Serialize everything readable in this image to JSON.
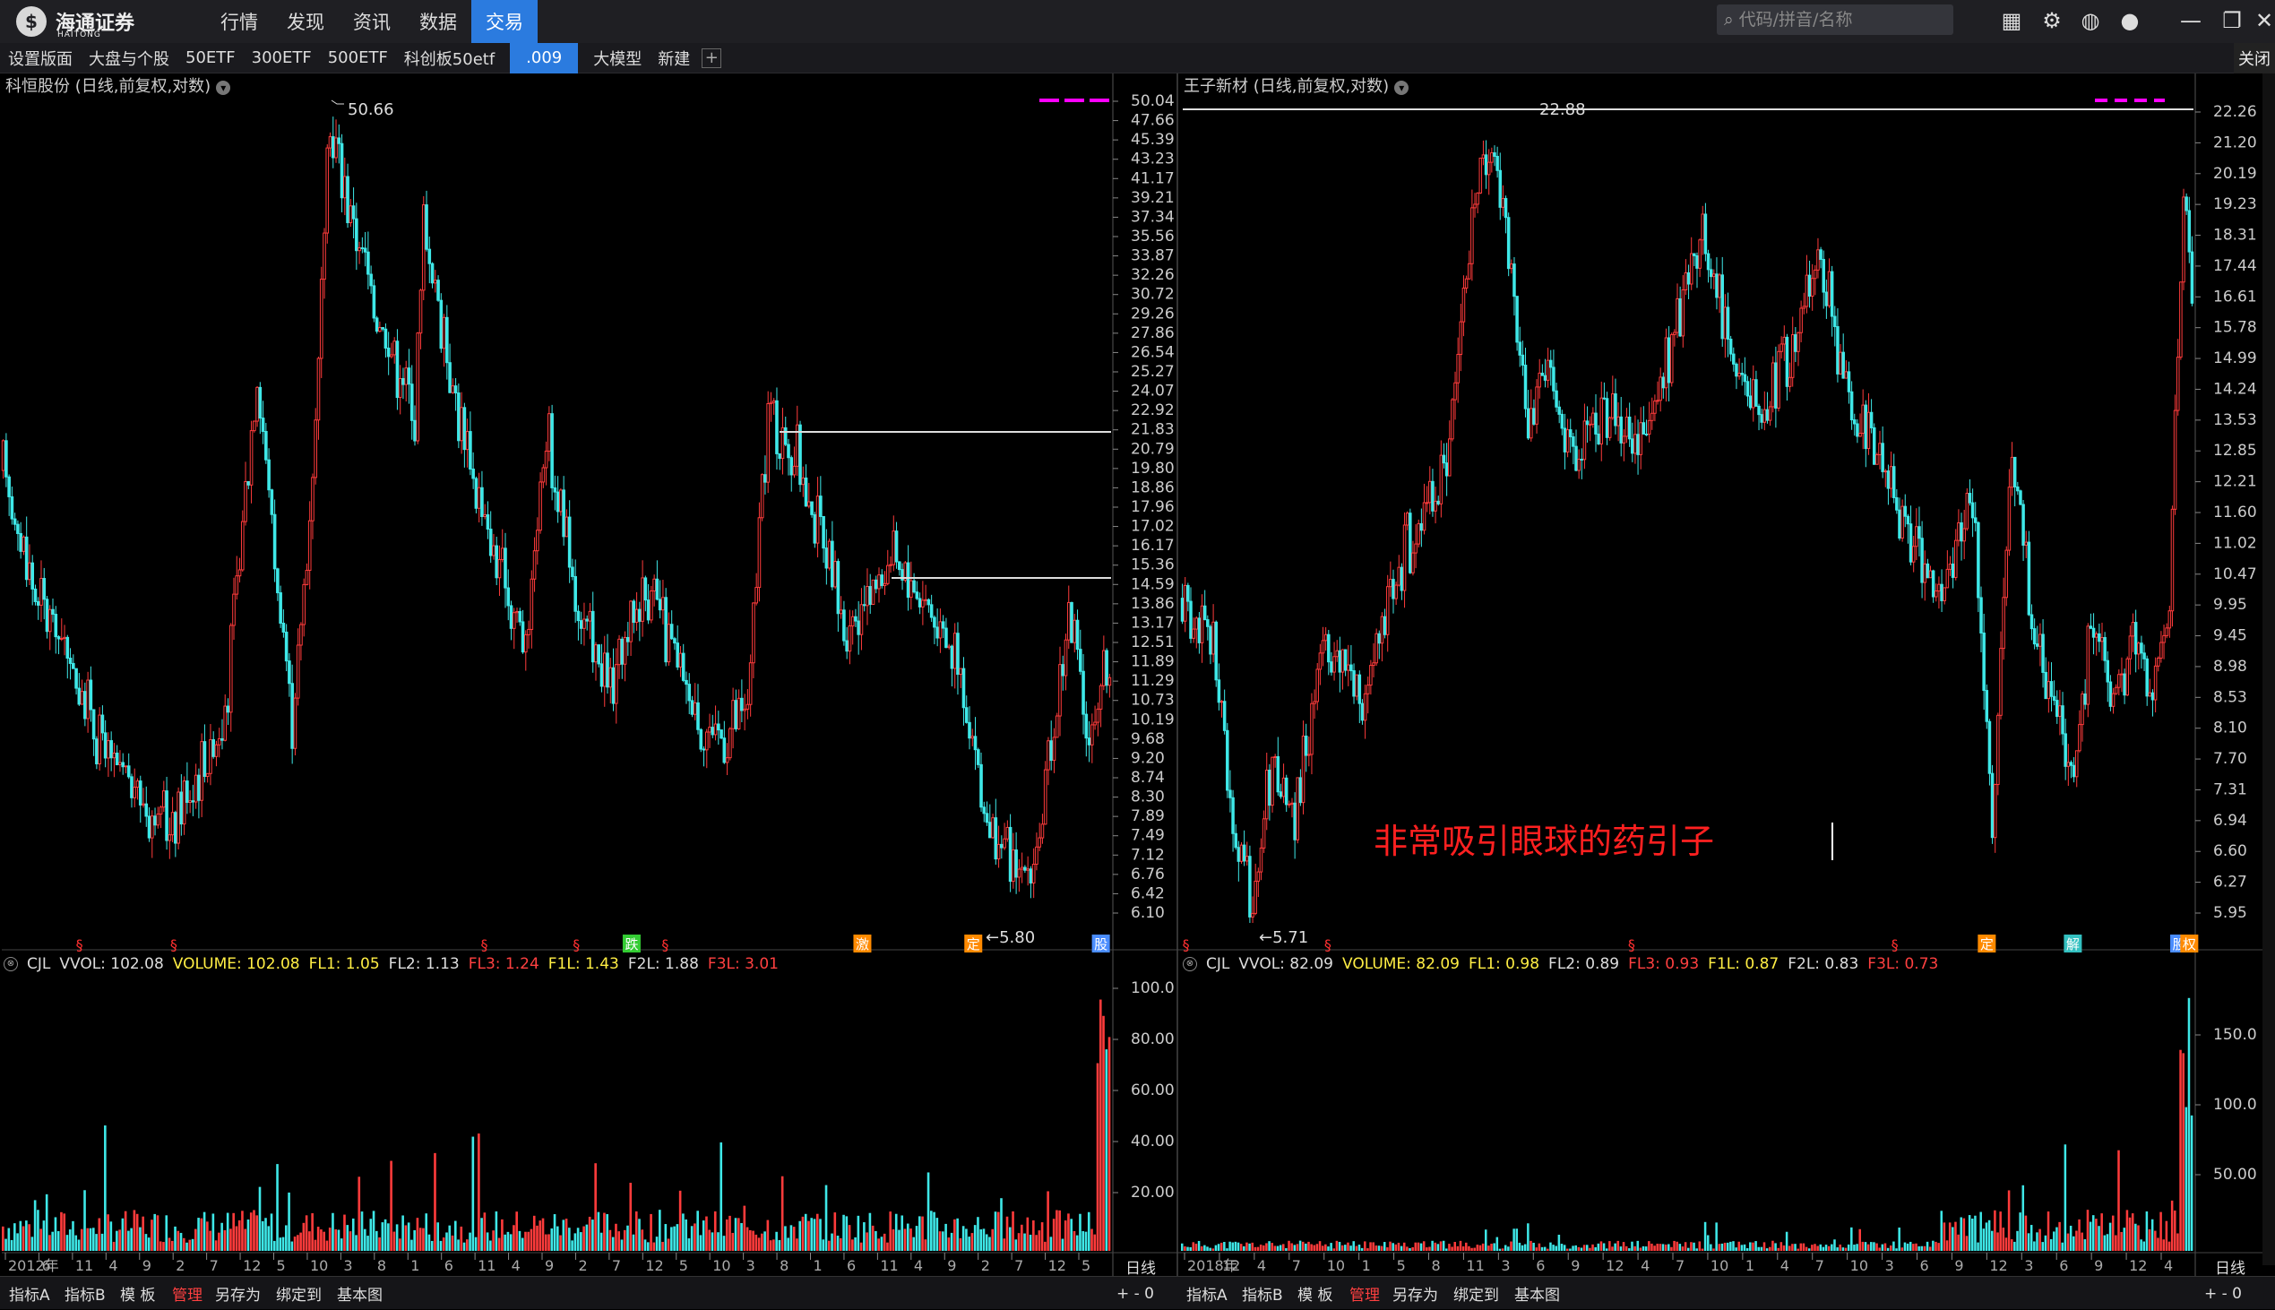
{
  "app": {
    "logo_text": "海通证券",
    "logo_sub": "HAITONG",
    "search_placeholder": "代码/拼音/名称"
  },
  "nav": [
    "行情",
    "发现",
    "资讯",
    "数据",
    "交易"
  ],
  "nav_active_index": 4,
  "tabs": [
    "设置版面",
    "大盘与个股",
    "50ETF",
    "300ETF",
    "500ETF",
    "科创板50etf",
    ".009",
    "大模型",
    "新建"
  ],
  "active_tab_index": 6,
  "close_label": "关闭",
  "colors": {
    "up": "#ff3b3b",
    "down": "#3ee8e8",
    "accent": "#2b7bdf",
    "magenta": "#ff00ff",
    "label_red": "#ff4040",
    "annotation": "#ff2020"
  },
  "left": {
    "title": "科恒股份 (日线,前复权,对数)",
    "high_label": "50.66",
    "low_label": "←5.80",
    "price_axis": [
      "50.04",
      "47.66",
      "45.39",
      "43.23",
      "41.17",
      "39.21",
      "37.34",
      "35.56",
      "33.87",
      "32.26",
      "30.72",
      "29.26",
      "27.86",
      "26.54",
      "25.27",
      "24.07",
      "22.92",
      "21.83",
      "20.79",
      "19.80",
      "18.86",
      "17.96",
      "17.02",
      "16.17",
      "15.36",
      "14.59",
      "13.86",
      "13.17",
      "12.51",
      "11.89",
      "11.29",
      "10.73",
      "10.19",
      "9.68",
      "9.20",
      "8.74",
      "8.30",
      "7.89",
      "7.49",
      "7.12",
      "6.76",
      "6.42",
      "6.10"
    ],
    "volume_axis": [
      "100.0",
      "80.00",
      "60.00",
      "40.00",
      "20.00"
    ],
    "indicator": {
      "name": "CJL",
      "vvol": "VVOL: 102.08",
      "volume": "VOLUME: 102.08",
      "fl1": "FL1: 1.05",
      "fl2": "FL2: 1.13",
      "fl3": "FL3: 1.24",
      "f1l": "F1L: 1.43",
      "f2l": "F2L: 1.88",
      "f3l": "F3L: 3.01"
    },
    "time_axis": [
      "2012年",
      "6",
      "11",
      "4",
      "9",
      "2",
      "7",
      "12",
      "5",
      "10",
      "3",
      "8",
      "1",
      "6",
      "11",
      "4",
      "9",
      "2",
      "7",
      "12",
      "5",
      "10",
      "3",
      "8",
      "1",
      "6",
      "11",
      "4",
      "9",
      "2",
      "7",
      "12",
      "5"
    ],
    "period_label": "日线",
    "markers": [
      {
        "t": 0.07,
        "text": "§",
        "kind": "s"
      },
      {
        "t": 0.155,
        "text": "§",
        "kind": "s"
      },
      {
        "t": 0.435,
        "text": "§",
        "kind": "s"
      },
      {
        "t": 0.518,
        "text": "§",
        "kind": "s"
      },
      {
        "t": 0.567,
        "text": "跌",
        "kind": "g"
      },
      {
        "t": 0.598,
        "text": "§",
        "kind": "s"
      },
      {
        "t": 0.775,
        "text": "激",
        "kind": "o"
      },
      {
        "t": 0.875,
        "text": "定",
        "kind": "o"
      },
      {
        "t": 0.99,
        "text": "股",
        "kind": "b"
      }
    ]
  },
  "right": {
    "title": "王子新材 (日线,前复权,对数)",
    "high_label": "22.88",
    "low_label": "←5.71",
    "price_axis": [
      "22.26",
      "21.20",
      "20.19",
      "19.23",
      "18.31",
      "17.44",
      "16.61",
      "15.78",
      "14.99",
      "14.24",
      "13.53",
      "12.85",
      "12.21",
      "11.60",
      "11.02",
      "10.47",
      "9.95",
      "9.45",
      "8.98",
      "8.53",
      "8.10",
      "7.70",
      "7.31",
      "6.94",
      "6.60",
      "6.27",
      "5.95"
    ],
    "volume_axis": [
      "150.0",
      "100.0",
      "50.00"
    ],
    "indicator": {
      "name": "CJL",
      "vvol": "VVOL: 82.09",
      "volume": "VOLUME: 82.09",
      "fl1": "FL1: 0.98",
      "fl2": "FL2: 0.89",
      "fl3": "FL3: 0.93",
      "f1l": "F1L: 0.87",
      "f2l": "F2L: 0.83",
      "f3l": "F3L: 0.73"
    },
    "time_axis": [
      "2018年",
      "12",
      "4",
      "7",
      "10",
      "1",
      "5",
      "8",
      "11",
      "3",
      "6",
      "9",
      "12",
      "4",
      "7",
      "10",
      "1",
      "4",
      "7",
      "10",
      "3",
      "6",
      "9",
      "12",
      "3",
      "6",
      "9",
      "12",
      "4"
    ],
    "period_label": "日线",
    "annotation": "非常吸引眼球的药引子",
    "markers": [
      {
        "t": 0.005,
        "text": "§",
        "kind": "s"
      },
      {
        "t": 0.145,
        "text": "§",
        "kind": "s"
      },
      {
        "t": 0.445,
        "text": "§",
        "kind": "s"
      },
      {
        "t": 0.705,
        "text": "§",
        "kind": "s"
      },
      {
        "t": 0.795,
        "text": "定",
        "kind": "o"
      },
      {
        "t": 0.88,
        "text": "解",
        "kind": "c"
      },
      {
        "t": 0.985,
        "text": "股",
        "kind": "b"
      },
      {
        "t": 0.995,
        "text": "权",
        "kind": "o"
      }
    ]
  },
  "bottom_tabs": [
    "指标A",
    "指标B",
    "模 板",
    "管理",
    "另存为",
    "绑定到",
    "基本图"
  ],
  "bottom_ctrl": "+ - 0"
}
